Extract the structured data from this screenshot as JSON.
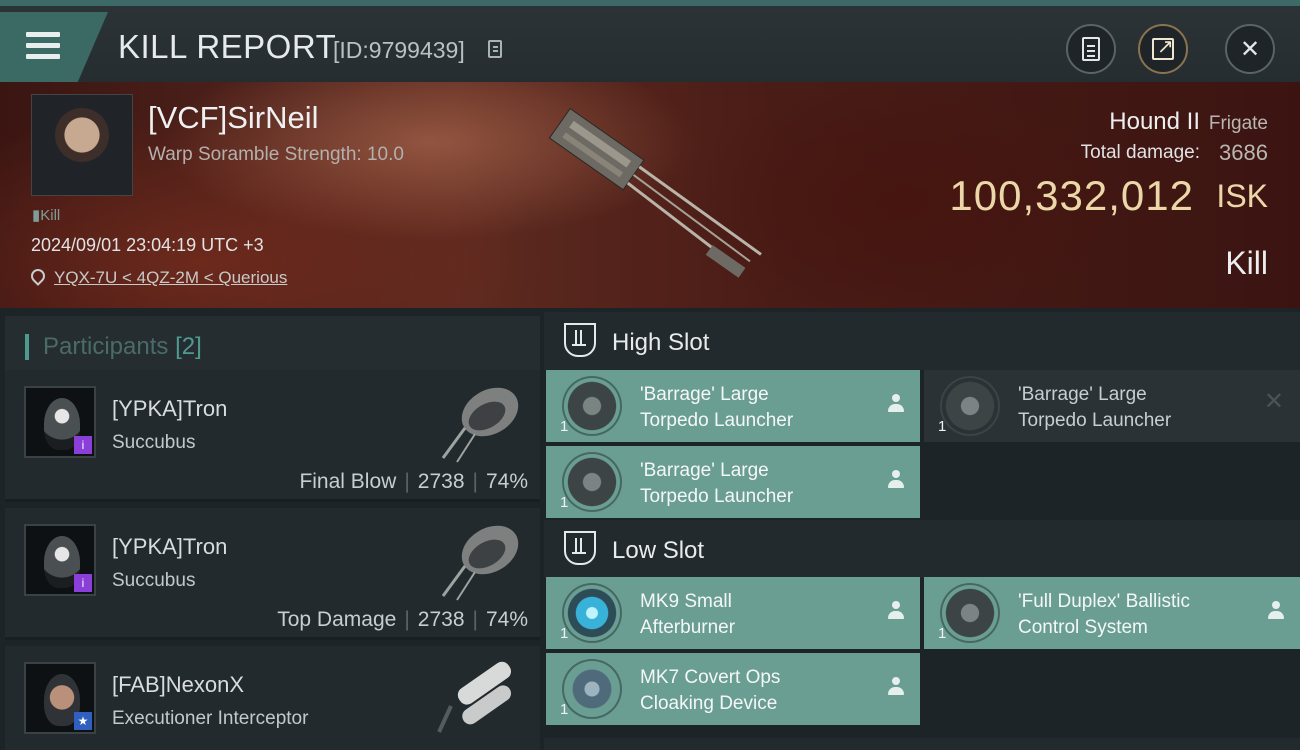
{
  "header": {
    "title": "KILL REPORT",
    "report_id": "[ID:9799439]",
    "icons": [
      "menu-icon",
      "copy-icon",
      "clipboard-icon",
      "share-icon",
      "close-icon"
    ]
  },
  "victim": {
    "name": "[VCF]SirNeil",
    "detail": "Warp Soramble Strength: 10.0",
    "tag": "Kill",
    "datetime": "2024/09/01 23:04:19 UTC +3",
    "location": "YQX-7U < 4QZ-2M < Querious",
    "ship_name": "Hound II",
    "ship_class": "Frigate",
    "damage_label": "Total damage:",
    "damage_value": "3686",
    "isk_value": "100,332,012",
    "isk_unit": "ISK",
    "outcome": "Kill"
  },
  "participants": {
    "title": "Participants",
    "count": "[2]",
    "rows": [
      {
        "name": "[YPKA]Tron",
        "ship": "Succubus",
        "role": "Final Blow",
        "damage": "2738",
        "percent": "74%"
      },
      {
        "name": "[YPKA]Tron",
        "ship": "Succubus",
        "role": "Top Damage",
        "damage": "2738",
        "percent": "74%"
      },
      {
        "name": "[FAB]NexonX",
        "ship": "Executioner Interceptor"
      }
    ]
  },
  "slots": {
    "high": {
      "title": "High Slot",
      "modules": [
        {
          "qty": "1",
          "line1": "'Barrage' Large",
          "line2": "Torpedo Launcher"
        },
        {
          "qty": "1",
          "line1": "'Barrage' Large",
          "line2": "Torpedo Launcher"
        },
        {
          "qty": "1",
          "line1": "'Barrage' Large",
          "line2": "Torpedo Launcher"
        }
      ]
    },
    "low": {
      "title": "Low Slot",
      "modules": [
        {
          "qty": "1",
          "line1": "MK9 Small",
          "line2": "Afterburner"
        },
        {
          "qty": "1",
          "line1": "'Full Duplex' Ballistic",
          "line2": "Control System"
        },
        {
          "qty": "1",
          "line1": "MK7 Covert Ops",
          "line2": "Cloaking Device"
        }
      ]
    }
  },
  "colors": {
    "accent": "#4f9a8f",
    "module_active": "#6b9e93",
    "isk_gold": "#ecd7a8",
    "banner": "#5d2a20"
  }
}
